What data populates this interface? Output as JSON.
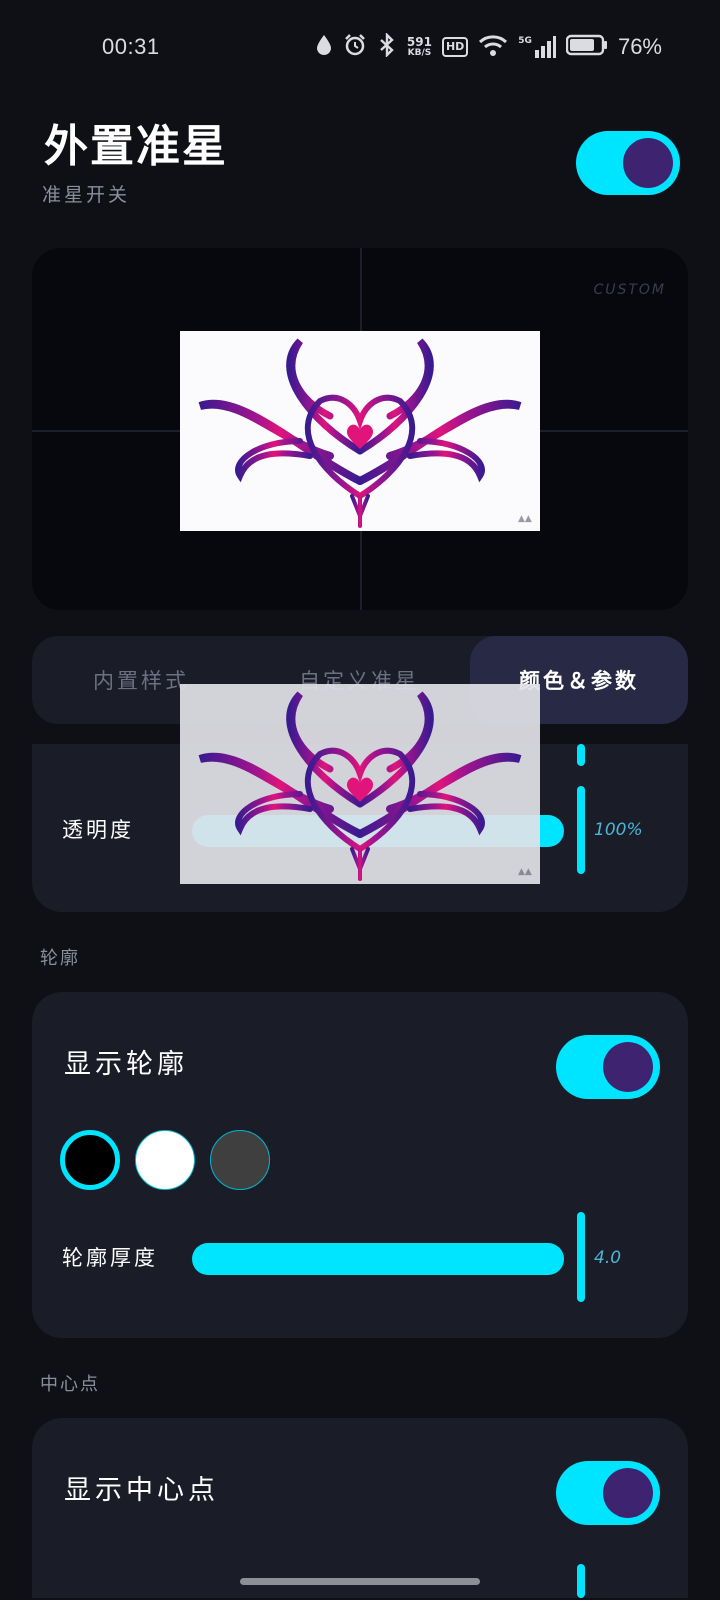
{
  "status_bar": {
    "time": "00:31",
    "net_speed_value": "591",
    "net_speed_unit": "KB/S",
    "hd_label": "HD",
    "signal_label": "5G",
    "battery_percent": "76%"
  },
  "header": {
    "title": "外置准星",
    "subtitle": "准星开关",
    "enabled": true
  },
  "preview": {
    "badge": "CUSTOM"
  },
  "tabs": [
    {
      "label": "内置样式",
      "active": false
    },
    {
      "label": "自定义准星",
      "active": false
    },
    {
      "label": "颜色＆参数",
      "active": true
    }
  ],
  "appearance": {
    "opacity_label": "透明度",
    "opacity_value": "100%",
    "opacity_fraction": 1.0
  },
  "outline": {
    "section_label": "轮廓",
    "show_label": "显示轮廓",
    "show_enabled": true,
    "colors": [
      "#000000",
      "#ffffff",
      "#3f3f3f"
    ],
    "selected_color_index": 0,
    "thickness_label": "轮廓厚度",
    "thickness_value": "4.0"
  },
  "center_dot": {
    "section_label": "中心点",
    "show_label": "显示中心点",
    "show_enabled": true
  },
  "colors": {
    "accent": "#00e5ff",
    "knob": "#3e2370",
    "card_bg": "#1a1c28",
    "page_bg": "#0e1016"
  }
}
